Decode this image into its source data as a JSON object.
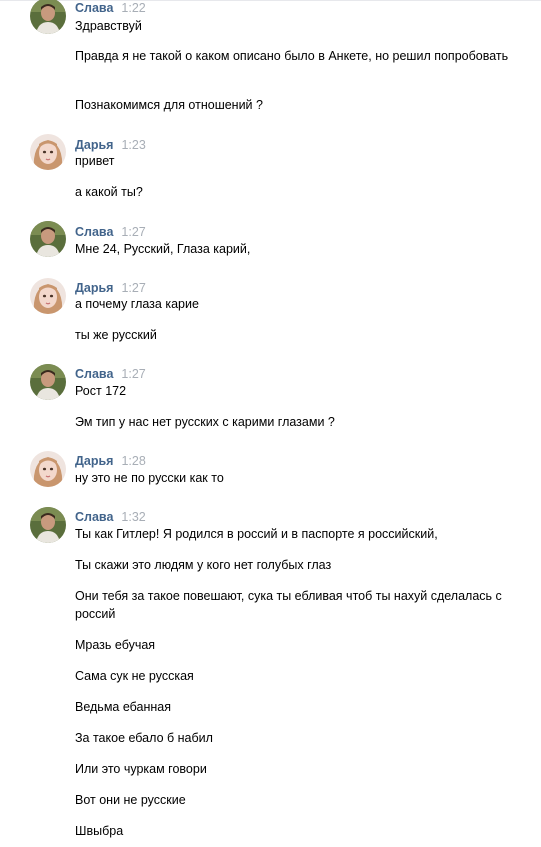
{
  "colors": {
    "author": "#42648b",
    "time": "#a8aeb6",
    "text": "#000000",
    "background": "#ffffff"
  },
  "groups": [
    {
      "author": "Слава",
      "time": "1:22",
      "avatar": "male-avatar",
      "messages": [
        "Здравствуй",
        "Правда я не такой о каком описано было в Анкете, но решил попробовать",
        "Познакомимся для отношений ?"
      ]
    },
    {
      "author": "Дарья",
      "time": "1:23",
      "avatar": "female-avatar",
      "messages": [
        "привет",
        "а какой ты?"
      ]
    },
    {
      "author": "Слава",
      "time": "1:27",
      "avatar": "male-avatar",
      "messages": [
        "Мне 24, Русский, Глаза карий,"
      ]
    },
    {
      "author": "Дарья",
      "time": "1:27",
      "avatar": "female-avatar",
      "messages": [
        "а почему глаза карие",
        "ты же русский"
      ]
    },
    {
      "author": "Слава",
      "time": "1:27",
      "avatar": "male-avatar",
      "messages": [
        "Рост 172",
        "Эм тип у нас нет русских с карими глазами ?"
      ]
    },
    {
      "author": "Дарья",
      "time": "1:28",
      "avatar": "female-avatar",
      "messages": [
        "ну это не по русски как то"
      ]
    },
    {
      "author": "Слава",
      "time": "1:32",
      "avatar": "male-avatar",
      "messages": [
        "Ты как Гитлер! Я родился в россий и в паспорте я российский,",
        "Ты скажи это людям у кого нет голубых глаз",
        "Они тебя за такое повешают, сука ты ебливая чтоб ты нахуй сделалась с россий",
        "Мразь ебучая",
        "Сама сук не русская",
        "Ведьма ебанная",
        "За такое ебало б набил",
        "Или это чуркам говори",
        "Вот они не русские",
        "Швыбра"
      ]
    }
  ]
}
